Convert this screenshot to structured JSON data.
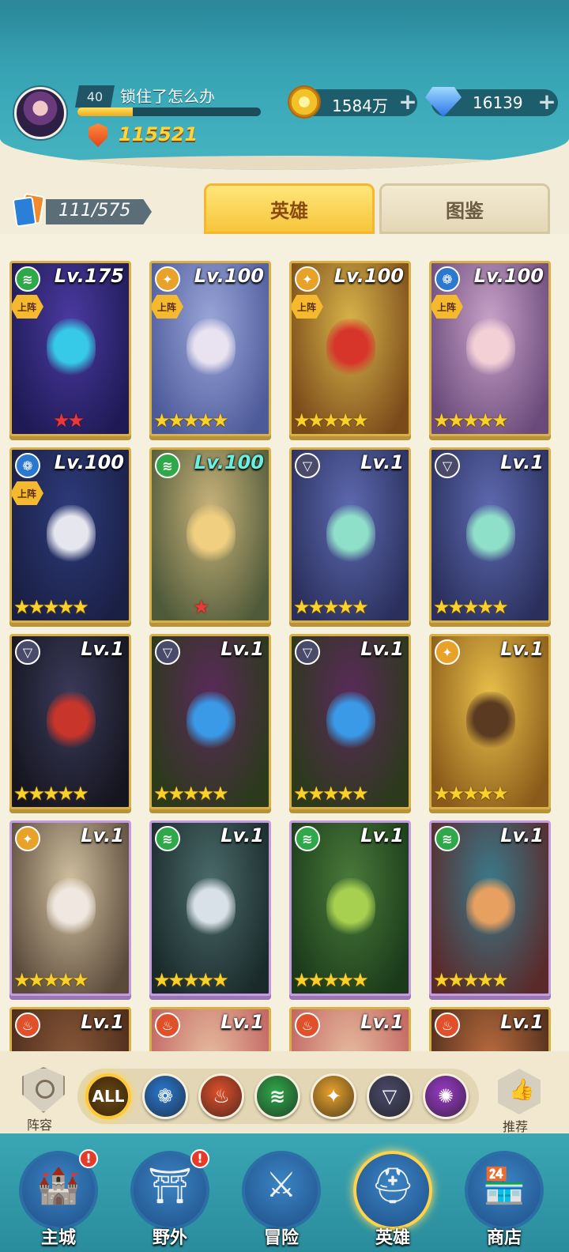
{
  "player": {
    "level": "40",
    "name": "锁住了怎么办",
    "xp_progress": 0.3,
    "power": "115521"
  },
  "resources": {
    "gold": "1584万",
    "gems": "16139"
  },
  "collection": {
    "count": "111/575"
  },
  "tabs": {
    "heroes": "英雄",
    "codex": "图鉴"
  },
  "deploy_label": "上阵",
  "heroes": [
    {
      "level": "Lv.175",
      "faction": "wind",
      "stars": 2,
      "star_color": "red",
      "deployed": true,
      "art": "#4a3aa0",
      "art2": "#1f1a55",
      "accent": "#37c9e8",
      "border": "gold"
    },
    {
      "level": "Lv.100",
      "faction": "light",
      "stars": 5,
      "star_color": "gold",
      "deployed": true,
      "art": "#9aa6d8",
      "art2": "#4d5a9a",
      "accent": "#e9e2f0",
      "border": "gold"
    },
    {
      "level": "Lv.100",
      "faction": "light",
      "stars": 5,
      "star_color": "gold",
      "deployed": true,
      "art": "#d8b44a",
      "art2": "#7a4a1a",
      "accent": "#d8352a",
      "border": "gold"
    },
    {
      "level": "Lv.100",
      "faction": "water",
      "stars": 5,
      "star_color": "gold",
      "deployed": true,
      "art": "#c8a2c8",
      "art2": "#6a4a7a",
      "accent": "#f2d0d6",
      "border": "gold"
    },
    {
      "level": "Lv.100",
      "faction": "water",
      "stars": 5,
      "star_color": "gold",
      "deployed": true,
      "art": "#2d3b7a",
      "art2": "#1a1f44",
      "accent": "#e6e6ee",
      "border": "gold"
    },
    {
      "level": "Lv.100",
      "faction": "wind",
      "stars": 1,
      "star_color": "red",
      "deployed": false,
      "art": "#c9b37a",
      "art2": "#4f5a3a",
      "accent": "#f0d080",
      "border": "gold",
      "level_color": "teal"
    },
    {
      "level": "Lv.1",
      "faction": "dark",
      "stars": 5,
      "star_color": "gold",
      "deployed": false,
      "art": "#5d6ab0",
      "art2": "#2a2f5c",
      "accent": "#8fe0c8",
      "border": "gold"
    },
    {
      "level": "Lv.1",
      "faction": "dark",
      "stars": 5,
      "star_color": "gold",
      "deployed": false,
      "art": "#5d6ab0",
      "art2": "#2a2f5c",
      "accent": "#8fe0c8",
      "border": "gold"
    },
    {
      "level": "Lv.1",
      "faction": "dark",
      "stars": 5,
      "star_color": "gold",
      "deployed": false,
      "art": "#3a3a5a",
      "art2": "#15151f",
      "accent": "#c8352a",
      "border": "gold"
    },
    {
      "level": "Lv.1",
      "faction": "dark",
      "stars": 5,
      "star_color": "gold",
      "deployed": false,
      "art": "#5a2a5a",
      "art2": "#2a3a1a",
      "accent": "#3a9ae8",
      "border": "gold"
    },
    {
      "level": "Lv.1",
      "faction": "dark",
      "stars": 5,
      "star_color": "gold",
      "deployed": false,
      "art": "#5a2a5a",
      "art2": "#2a3a1a",
      "accent": "#3a9ae8",
      "border": "gold"
    },
    {
      "level": "Lv.1",
      "faction": "light",
      "stars": 5,
      "star_color": "gold",
      "deployed": false,
      "art": "#e8c04a",
      "art2": "#8a5a1a",
      "accent": "#5a3a20",
      "border": "gold"
    },
    {
      "level": "Lv.1",
      "faction": "light",
      "stars": 5,
      "star_color": "gold",
      "deployed": false,
      "art": "#d0c0a0",
      "art2": "#5a4a3a",
      "accent": "#f0e8e0",
      "border": "purple"
    },
    {
      "level": "Lv.1",
      "faction": "wind",
      "stars": 5,
      "star_color": "gold",
      "deployed": false,
      "art": "#4a6a6a",
      "art2": "#1a2a2a",
      "accent": "#d8e0e8",
      "border": "purple"
    },
    {
      "level": "Lv.1",
      "faction": "wind",
      "stars": 5,
      "star_color": "gold",
      "deployed": false,
      "art": "#4a7a3a",
      "art2": "#1a3a1a",
      "accent": "#a8d050",
      "border": "purple"
    },
    {
      "level": "Lv.1",
      "faction": "wind",
      "stars": 5,
      "star_color": "gold",
      "deployed": false,
      "art": "#3a7a8a",
      "art2": "#5a2a2a",
      "accent": "#e8a060",
      "border": "purple"
    },
    {
      "level": "Lv.1",
      "faction": "fire",
      "stars": 0,
      "star_color": "gold",
      "deployed": false,
      "art": "#8a5a3a",
      "art2": "#4a2a1a",
      "accent": "#e0d0b0",
      "border": "gold"
    },
    {
      "level": "Lv.1",
      "faction": "fire",
      "stars": 0,
      "star_color": "gold",
      "deployed": false,
      "art": "#e8c0a0",
      "art2": "#c06060",
      "accent": "#f0e0d0",
      "border": "gold"
    },
    {
      "level": "Lv.1",
      "faction": "fire",
      "stars": 0,
      "star_color": "gold",
      "deployed": false,
      "art": "#e8c0a0",
      "art2": "#c06060",
      "accent": "#f0e0d0",
      "border": "gold"
    },
    {
      "level": "Lv.1",
      "faction": "fire",
      "stars": 0,
      "star_color": "gold",
      "deployed": false,
      "art": "#c07040",
      "art2": "#4a2a1a",
      "accent": "#f0c080",
      "border": "gold"
    }
  ],
  "factions": {
    "wind": {
      "color": "#2fa84a",
      "glyph": "≋",
      "icon": "wind-faction-icon"
    },
    "light": {
      "color": "#e8a22a",
      "glyph": "✦",
      "icon": "light-faction-icon"
    },
    "water": {
      "color": "#2a78d0",
      "glyph": "❁",
      "icon": "water-faction-icon"
    },
    "dark": {
      "color": "#4a4a6a",
      "glyph": "▽",
      "icon": "dark-faction-icon"
    },
    "fire": {
      "color": "#e0502a",
      "glyph": "♨",
      "icon": "fire-faction-icon"
    }
  },
  "filters": {
    "lineup_label": "阵容",
    "recommend_label": "推荐",
    "all_label": "ALL",
    "items": [
      {
        "icon": "water-filter-icon",
        "color": "#2a78d0",
        "glyph": "❁"
      },
      {
        "icon": "fire-filter-icon",
        "color": "#e0502a",
        "glyph": "♨"
      },
      {
        "icon": "wind-filter-icon",
        "color": "#2fa84a",
        "glyph": "≋"
      },
      {
        "icon": "light-filter-icon",
        "color": "#e8a22a",
        "glyph": "✦"
      },
      {
        "icon": "dark-filter-icon",
        "color": "#4a4a6a",
        "glyph": "▽"
      },
      {
        "icon": "chaos-filter-icon",
        "color": "#9a3ac8",
        "glyph": "✺"
      }
    ]
  },
  "nav": [
    {
      "label": "主城",
      "icon": "castle-icon",
      "glyph": "🏰",
      "alert": true,
      "active": false
    },
    {
      "label": "野外",
      "icon": "portal-icon",
      "glyph": "⛩",
      "alert": true,
      "active": false
    },
    {
      "label": "冒险",
      "icon": "sword-icon",
      "glyph": "⚔",
      "alert": false,
      "active": false
    },
    {
      "label": "英雄",
      "icon": "helmet-icon",
      "glyph": "⛑",
      "alert": false,
      "active": true
    },
    {
      "label": "商店",
      "icon": "shop-icon",
      "glyph": "🏪",
      "alert": false,
      "active": false
    }
  ],
  "colors": {
    "accent_gold": "#ffd23a",
    "header_teal": "#3aa8b8",
    "alert_red": "#e63a2a"
  }
}
